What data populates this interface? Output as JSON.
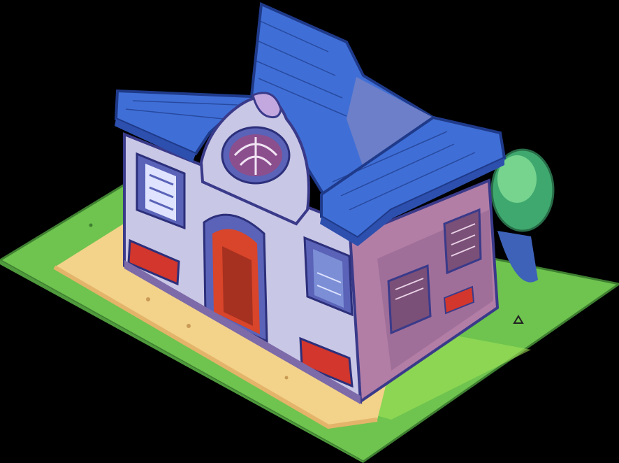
{
  "scene": {
    "subject": "isometric-house-tile",
    "background": "#000000"
  },
  "colors": {
    "grass": "#6ec44e",
    "grass_dark": "#4f9a3c",
    "path": "#f3d28a",
    "path_dark": "#e3b46a",
    "roof": "#3f6fd6",
    "roof_dark": "#2d4fae",
    "roof_line": "#1f3a8a",
    "wall_front": "#c9c7e6",
    "wall_side": "#b27ea6",
    "wall_side_dark": "#8e5f8c",
    "trim": "#5a63b8",
    "door": "#d9452a",
    "window_glass": "#7c8fd6",
    "flower_box": "#d2362c",
    "bush": "#3fa86e",
    "bush_light": "#77d48f"
  }
}
